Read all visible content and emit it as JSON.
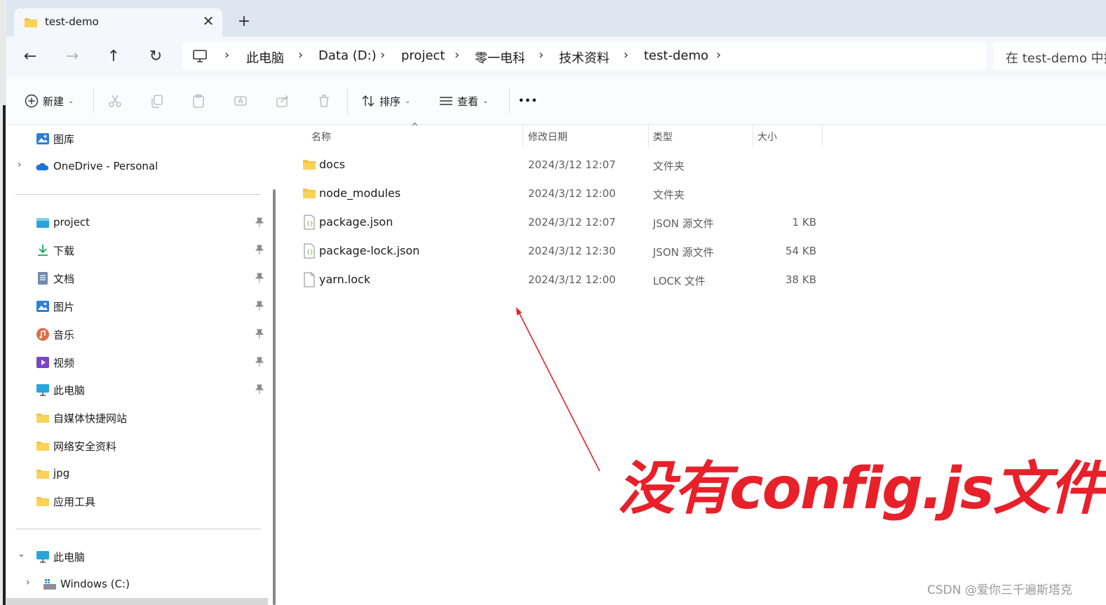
{
  "tab": {
    "title": "test-demo",
    "close_glyph": "✕",
    "add_glyph": "+"
  },
  "nav": {
    "back_glyph": "←",
    "forward_glyph": "→",
    "up_glyph": "↑",
    "refresh_glyph": "↻",
    "breadcrumbs": [
      "此电脑",
      "Data (D:)",
      "project",
      "零一电科",
      "技术资料",
      "test-demo"
    ],
    "sep": "›",
    "search_placeholder": "在 test-demo 中搜"
  },
  "toolbar": {
    "new_label": "新建",
    "sort_label": "排序",
    "view_label": "查看",
    "more_glyph": "•••"
  },
  "sidebar": {
    "top": [
      {
        "label": "图库",
        "icon": "gallery-icon"
      },
      {
        "label": "OneDrive - Personal",
        "icon": "onedrive-cloud-icon"
      }
    ],
    "quick": [
      {
        "label": "project",
        "icon": "project-folder-icon",
        "pinned": true
      },
      {
        "label": "下载",
        "icon": "download-icon",
        "pinned": true
      },
      {
        "label": "文档",
        "icon": "documents-icon",
        "pinned": true
      },
      {
        "label": "图片",
        "icon": "pictures-icon",
        "pinned": true
      },
      {
        "label": "音乐",
        "icon": "music-icon",
        "pinned": true
      },
      {
        "label": "视频",
        "icon": "videos-icon",
        "pinned": true
      },
      {
        "label": "此电脑",
        "icon": "this-pc-icon",
        "pinned": true
      },
      {
        "label": "自媒体快捷网站",
        "icon": "folder-icon",
        "pinned": false
      },
      {
        "label": "网络安全资料",
        "icon": "folder-icon",
        "pinned": false
      },
      {
        "label": "jpg",
        "icon": "folder-icon",
        "pinned": false
      },
      {
        "label": "应用工具",
        "icon": "folder-icon",
        "pinned": false
      }
    ],
    "tree": [
      {
        "label": "此电脑",
        "icon": "this-pc-icon",
        "expanded": true
      },
      {
        "label": "Windows (C:)",
        "icon": "windows-drive-icon",
        "expanded": false
      }
    ]
  },
  "table": {
    "headers": {
      "name": "名称",
      "date": "修改日期",
      "type": "类型",
      "size": "大小"
    },
    "sort_glyph": "^",
    "rows": [
      {
        "name": "docs",
        "date": "2024/3/12 12:07",
        "type": "文件夹",
        "size": "",
        "icon": "folder-icon"
      },
      {
        "name": "node_modules",
        "date": "2024/3/12 12:00",
        "type": "文件夹",
        "size": "",
        "icon": "folder-icon"
      },
      {
        "name": "package.json",
        "date": "2024/3/12 12:07",
        "type": "JSON 源文件",
        "size": "1 KB",
        "icon": "json-file-icon"
      },
      {
        "name": "package-lock.json",
        "date": "2024/3/12 12:30",
        "type": "JSON 源文件",
        "size": "54 KB",
        "icon": "json-file-icon"
      },
      {
        "name": "yarn.lock",
        "date": "2024/3/12 12:00",
        "type": "LOCK 文件",
        "size": "38 KB",
        "icon": "generic-file-icon"
      }
    ]
  },
  "annotation": {
    "text": "没有config.js文件",
    "color": "#e8202a"
  },
  "watermark": "CSDN @爱你三千遍斯塔克",
  "colors": {
    "folder": "#f8c336",
    "accent": "#0067c0",
    "tabbar": "#dde6f1"
  }
}
